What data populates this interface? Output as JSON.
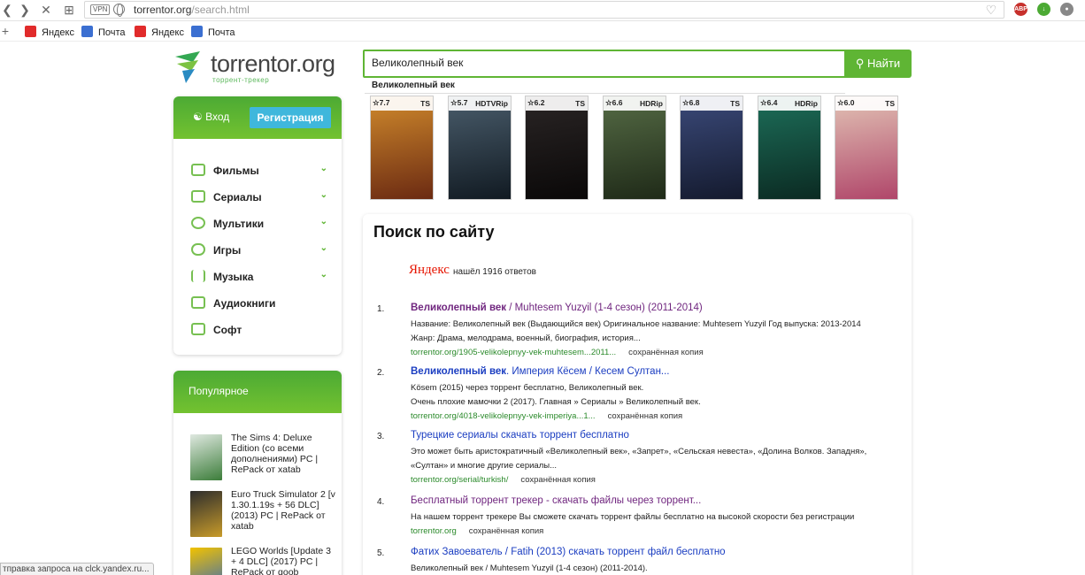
{
  "browser": {
    "vpn_label": "VPN",
    "url_host": "torrentor.org",
    "url_path": "/search.html",
    "bookmarks": [
      {
        "label": "Яндекс",
        "icon": "yandex-zen-icon",
        "color": "#e12b2b"
      },
      {
        "label": "Почта",
        "icon": "mail-icon",
        "color": "#3b6fd1"
      },
      {
        "label": "Яндекс",
        "icon": "yandex-icon",
        "color": "#e12b2b"
      },
      {
        "label": "Почта",
        "icon": "mail-icon",
        "color": "#3b6fd1"
      }
    ],
    "extensions": [
      {
        "name": "adblock-icon",
        "text": "ABP",
        "color": "#c7302c"
      },
      {
        "name": "download-icon",
        "text": "↓",
        "color": "#4caa34"
      },
      {
        "name": "globe-ext-icon",
        "text": "●",
        "color": "#888888"
      }
    ]
  },
  "site": {
    "logo_text": "torrentor.org",
    "logo_sub": "торрент-трекер",
    "accent": "#5fb534",
    "search": {
      "value": "Великолепный век",
      "button_label": "Найти",
      "suggestion": "Великолепный век"
    },
    "sidebar": {
      "login_label": "Вход",
      "register_label": "Регистрация",
      "menu": [
        {
          "label": "Фильмы",
          "has_sub": true,
          "icon": "film-icon"
        },
        {
          "label": "Сериалы",
          "has_sub": true,
          "icon": "tv-icon"
        },
        {
          "label": "Мультики",
          "has_sub": true,
          "icon": "cartoon-icon"
        },
        {
          "label": "Игры",
          "has_sub": true,
          "icon": "gamepad-icon"
        },
        {
          "label": "Музыка",
          "has_sub": true,
          "icon": "music-icon"
        },
        {
          "label": "Аудиокниги",
          "has_sub": false,
          "icon": "audiobook-icon"
        },
        {
          "label": "Софт",
          "has_sub": false,
          "icon": "software-icon"
        }
      ],
      "popular_title": "Популярное",
      "popular": [
        {
          "title": "The Sims 4: Deluxe Edition (со всеми дополнениями) PC | RePack от xatab",
          "color": "#3c7d3a"
        },
        {
          "title": "Euro Truck Simulator 2 [v 1.30.1.19s + 56 DLC] (2013) PC | RePack от xatab",
          "color": "#c89b2a"
        },
        {
          "title": "LEGO Worlds [Update 3 + 4 DLC] (2017) PC | RePack от qoob",
          "color": "#2f66c0"
        }
      ]
    },
    "posters": [
      {
        "rating": "7.7",
        "quality": "TS",
        "c1": "#d08a2c",
        "c2": "#6b2a12"
      },
      {
        "rating": "5.7",
        "quality": "HDTVRip",
        "c1": "#4a5d6c",
        "c2": "#111a22"
      },
      {
        "rating": "6.2",
        "quality": "TS",
        "c1": "#2a2525",
        "c2": "#0a0808"
      },
      {
        "rating": "6.6",
        "quality": "HDRip",
        "c1": "#556b45",
        "c2": "#1f2a18"
      },
      {
        "rating": "6.8",
        "quality": "TS",
        "c1": "#3b4a7a",
        "c2": "#141a2e"
      },
      {
        "rating": "6.4",
        "quality": "HDRip",
        "c1": "#1d6f5a",
        "c2": "#0b2a22"
      },
      {
        "rating": "6.0",
        "quality": "TS",
        "c1": "#e2c3b5",
        "c2": "#b0466a"
      }
    ],
    "results_panel": {
      "title": "Поиск по сайту",
      "yandex_logo": "Яндекс",
      "found_text": "нашёл 1916 ответов",
      "copy_label": "сохранённая копия",
      "results": [
        {
          "num": "1.",
          "title_bold": "Великолепный век",
          "title_rest": " / Muhtesem Yuzyil (1-4 сезон) (2011-2014)",
          "visited": true,
          "lines": [
            "Название: Великолепный век (Выдающийся век) Оригинальное название: Muhtesem Yuzyil Год выпуска: 2013-2014",
            "Жанр: Драма, мелодрама, военный, биография, история..."
          ],
          "url": "torrentor.org/1905-velikolepnyy-vek-muhtesem...2011..."
        },
        {
          "num": "2.",
          "title_bold": "Великолепный век",
          "title_rest": ". Империя Кёсем / Кесем Султан...",
          "visited": false,
          "lines": [
            "Kösem (2015) через торрент бесплатно, Великолепный век.",
            "Очень плохие мамочки 2 (2017). Главная » Сериалы » Великолепный век."
          ],
          "url": "torrentor.org/4018-velikolepnyy-vek-imperiya...1..."
        },
        {
          "num": "3.",
          "title_bold": "",
          "title_rest": "Турецкие сериалы скачать торрент бесплатно",
          "visited": false,
          "lines": [
            "Это может быть аристократичный «Великолепный век», «Запрет», «Сельская невеста», «Долина Волков. Западня»,",
            "«Султан» и многие другие сериалы..."
          ],
          "url": "torrentor.org/serial/turkish/"
        },
        {
          "num": "4.",
          "title_bold": "",
          "title_rest": "Бесплатный торрент трекер - скачать файлы через торрент...",
          "visited": true,
          "lines": [
            "На нашем торрент трекере Вы сможете скачать торрент файлы бесплатно на высокой скорости без регистрации"
          ],
          "url": "torrentor.org"
        },
        {
          "num": "5.",
          "title_bold": "",
          "title_rest": "Фатих Завоеватель / Fatih (2013) скачать торрент файл бесплатно",
          "visited": false,
          "lines": [
            "Великолепный век / Muhtesem Yuzyil (1-4 сезон) (2011-2014)."
          ],
          "url": ""
        }
      ]
    }
  },
  "status_bar": "тправка запроса на clck.yandex.ru..."
}
